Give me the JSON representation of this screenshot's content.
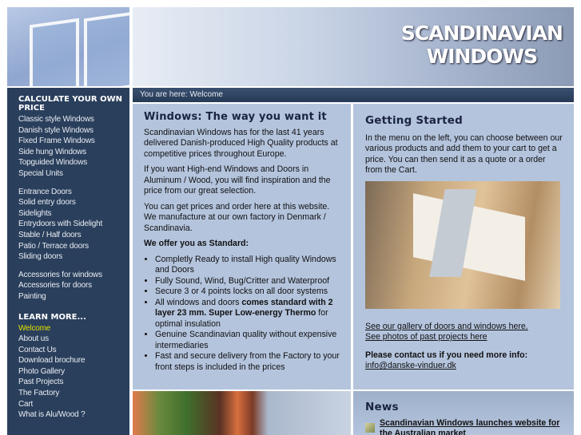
{
  "header": {
    "logo_line1": "SCANDINAVIAN",
    "logo_line2": "WINDOWS"
  },
  "sidebar": {
    "heading1": "CALCULATE YOUR OWN PRICE",
    "group1": [
      "Classic style Windows",
      "Danish style Windows",
      "Fixed Frame Windows",
      "Side hung Windows",
      "Topguided Windows",
      "Special Units"
    ],
    "group2": [
      "Entrance Doors",
      "Solid entry doors",
      "Sidelights",
      "Entrydoors with Sidelight",
      "Stable / Half doors",
      "Patio / Terrace doors",
      "Sliding doors"
    ],
    "group3": [
      "Accessories for windows",
      "Accessories for doors",
      "Painting"
    ],
    "heading2": "LEARN MORE...",
    "group4": [
      "Welcome",
      "About us",
      "Contact Us",
      "Download brochure",
      "Photo Gallery",
      "Past Projects",
      "The Factory",
      "Cart",
      "What is Alu/Wood ?"
    ],
    "active": "Welcome",
    "active_color": "#e0e000"
  },
  "breadcrumb": {
    "prefix": "You are here:",
    "current": "Welcome"
  },
  "main": {
    "title": "Windows: The way you want it",
    "p1": "Scandinavian Windows has for the last 41 years delivered Danish-produced High Quality products at competitive prices throughout Europe.",
    "p2": "If you want High-end Windows and Doors in Aluminum / Wood, you will find inspiration and the price from our great selection.",
    "p3": "You can get prices and order here at this website. We manufacture at our own factory in Denmark / Scandinavia.",
    "standard_heading": "We offer you as Standard:",
    "bullets": [
      "Completly Ready to install High quality Windows and Doors",
      "Fully Sound, Wind, Bug/Critter and Waterproof",
      "Secure 3 or 4 points locks on all door systems"
    ],
    "bullet4_pre": "All windows and doors ",
    "bullet4_bold": "comes standard with 2 layer 23 mm. Super Low-energy Thermo",
    "bullet4_post": " for optimal insulation",
    "bullets_after": [
      "Genuine Scandinavian quality without expensive intermediaries",
      "Fast and secure delivery from the Factory to your front steps is included in the prices"
    ]
  },
  "getting_started": {
    "title": "Getting Started",
    "text": "In the menu on the left, you can choose between our various products and add them to your cart to get a price. You can then send it as a quote or a order from the Cart.",
    "link1": "See our gallery of doors and windows here.",
    "link2": "See photos of past projects here",
    "contact_label": "Please contact us if you need more info:",
    "email": "info@danske-vinduer.dk"
  },
  "news": {
    "title": "News",
    "items": [
      "Scandinavian Windows launches website for the Australian market"
    ]
  },
  "colors": {
    "sidebar": "#2a3f5c",
    "content": "#b4c4dd"
  }
}
